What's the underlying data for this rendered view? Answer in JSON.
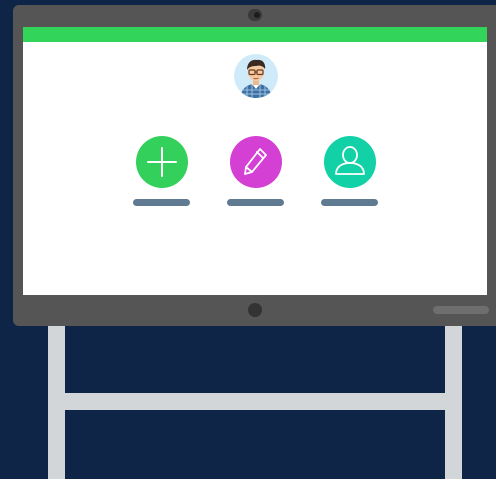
{
  "colors": {
    "background": "#0f2548",
    "stand": "#d3d6d9",
    "device_frame": "#555555",
    "camera": "#3a3a3a",
    "screen_header": "#32d45a",
    "label_bar": "#5f7a91",
    "home_button": "#333333",
    "speaker_slot": "#6e6e6e",
    "icon_stroke": "#ffffff"
  },
  "screen": {
    "avatar": {
      "icon": "user-avatar-illustration",
      "bg": "#cfeaf8"
    },
    "tiles": [
      {
        "id": "add",
        "icon": "plus-icon",
        "color": "#33d15c"
      },
      {
        "id": "edit",
        "icon": "pencil-icon",
        "color": "#d43fd4"
      },
      {
        "id": "profile",
        "icon": "user-icon",
        "color": "#12d1a6"
      }
    ]
  }
}
